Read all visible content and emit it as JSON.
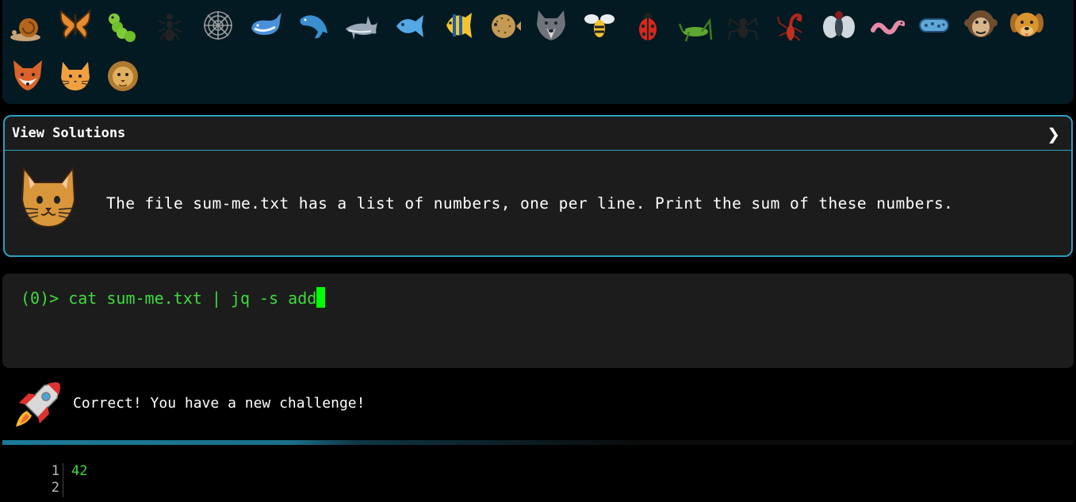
{
  "achievements": {
    "critters": [
      {
        "name": "snail-icon",
        "label": "snail"
      },
      {
        "name": "butterfly-icon",
        "label": "butterfly"
      },
      {
        "name": "caterpillar-icon",
        "label": "caterpillar"
      },
      {
        "name": "ant-icon",
        "label": "ant"
      },
      {
        "name": "spider-web-icon",
        "label": "spider web"
      },
      {
        "name": "whale-icon",
        "label": "whale"
      },
      {
        "name": "dolphin-icon",
        "label": "dolphin"
      },
      {
        "name": "shark-icon",
        "label": "shark"
      },
      {
        "name": "fish-icon",
        "label": "fish"
      },
      {
        "name": "tropical-fish-icon",
        "label": "tropical fish"
      },
      {
        "name": "blowfish-icon",
        "label": "blowfish"
      },
      {
        "name": "wolf-icon",
        "label": "wolf"
      },
      {
        "name": "bee-icon",
        "label": "bee"
      },
      {
        "name": "ladybug-icon",
        "label": "ladybug"
      },
      {
        "name": "cricket-icon",
        "label": "cricket"
      },
      {
        "name": "spider-icon",
        "label": "spider"
      },
      {
        "name": "scorpion-icon",
        "label": "scorpion"
      },
      {
        "name": "fly-icon",
        "label": "fly"
      },
      {
        "name": "worm-icon",
        "label": "worm"
      },
      {
        "name": "microbe-icon",
        "label": "microbe"
      },
      {
        "name": "monkey-icon",
        "label": "monkey"
      },
      {
        "name": "dog-icon",
        "label": "dog"
      },
      {
        "name": "fox-icon",
        "label": "fox"
      },
      {
        "name": "cat-icon",
        "label": "cat"
      },
      {
        "name": "lion-icon",
        "label": "lion"
      }
    ]
  },
  "challenge": {
    "header": "View Solutions",
    "expand_icon": "chevron-right-icon",
    "avatar_icon": "cat-icon",
    "description": "The file sum-me.txt has a list of numbers, one per line. Print the sum of these numbers."
  },
  "terminal": {
    "prompt": "(0)> ",
    "command": "cat sum-me.txt | jq -s add"
  },
  "result": {
    "icon": "rocket-icon",
    "message": "Correct! You have a new challenge!",
    "progress": 0.6
  },
  "output": {
    "line_numbers": [
      "1",
      "2"
    ],
    "lines": [
      "42",
      ""
    ]
  },
  "colors": {
    "accent": "#2c9fc0",
    "prompt_green": "#3ddc3d",
    "cursor_green": "#00ff00",
    "panel_bg": "#1c1c1c",
    "achievements_bg": "#031a22"
  }
}
